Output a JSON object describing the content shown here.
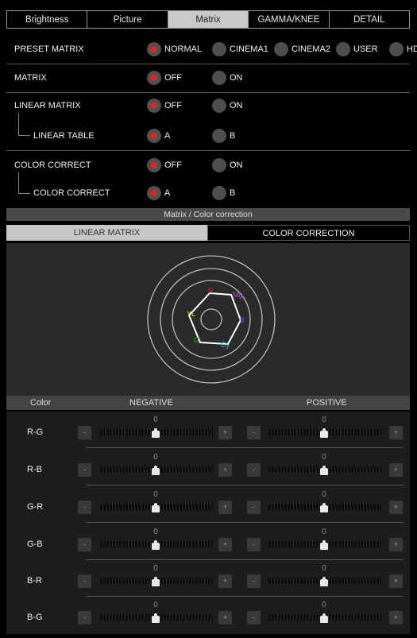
{
  "tabs": [
    {
      "label": "Brightness",
      "active": false
    },
    {
      "label": "Picture",
      "active": false
    },
    {
      "label": "Matrix",
      "active": true
    },
    {
      "label": "GAMMA/KNEE",
      "active": false
    },
    {
      "label": "DETAIL",
      "active": false
    }
  ],
  "preset_matrix": {
    "label": "PRESET MATRIX",
    "options": [
      "NORMAL",
      "CINEMA1",
      "CINEMA2",
      "USER",
      "HD"
    ],
    "selected": "NORMAL"
  },
  "matrix": {
    "label": "MATRIX",
    "options": [
      "OFF",
      "ON"
    ],
    "selected": "OFF"
  },
  "linear_matrix": {
    "label": "LINEAR MATRIX",
    "options": [
      "OFF",
      "ON"
    ],
    "selected": "OFF"
  },
  "linear_table": {
    "label": "LINEAR TABLE",
    "options": [
      "A",
      "B"
    ],
    "selected": "A"
  },
  "color_correct": {
    "label": "COLOR CORRECT",
    "options": [
      "OFF",
      "ON"
    ],
    "selected": "OFF"
  },
  "color_correct_table": {
    "label": "COLOR CORRECT",
    "options": [
      "A",
      "B"
    ],
    "selected": "A"
  },
  "section_title": "Matrix / Color correction",
  "subtabs": [
    {
      "label": "LINEAR MATRIX",
      "active": true
    },
    {
      "label": "COLOR CORRECTION",
      "active": false
    }
  ],
  "vectorscope": {
    "labels": {
      "R": "R",
      "Mg": "Mg",
      "B": "B",
      "Cy": "Cy",
      "G": "G",
      "YL": "YL"
    },
    "colors": {
      "R": "#e02020",
      "Mg": "#c040d0",
      "B": "#4a5ce0",
      "Cy": "#20b8c8",
      "G": "#20c020",
      "YL": "#e8e020"
    }
  },
  "color_table": {
    "header": {
      "color": "Color",
      "negative": "NEGATIVE",
      "positive": "POSITIVE"
    },
    "minus": "-",
    "plus": "+",
    "rows": [
      {
        "name": "R-G",
        "negative": "0",
        "positive": "0"
      },
      {
        "name": "R-B",
        "negative": "0",
        "positive": "0"
      },
      {
        "name": "G-R",
        "negative": "0",
        "positive": "0"
      },
      {
        "name": "G-B",
        "negative": "0",
        "positive": "0"
      },
      {
        "name": "B-R",
        "negative": "0",
        "positive": "0"
      },
      {
        "name": "B-G",
        "negative": "0",
        "positive": "0"
      }
    ]
  },
  "colors": {
    "selected_radio": "#e52222",
    "active_tab": "#c9c9c9"
  }
}
